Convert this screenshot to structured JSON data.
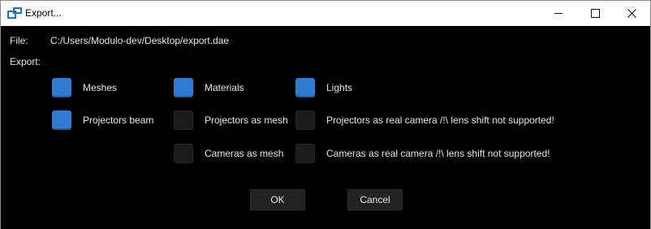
{
  "window": {
    "title": "Export...",
    "icons": {
      "app": "app-logo-icon",
      "minimize": "minimize-icon",
      "maximize": "maximize-icon",
      "close": "close-icon"
    }
  },
  "file": {
    "label": "File:",
    "path": "C:/Users/Modulo-dev/Desktop/export.dae"
  },
  "export": {
    "label": "Export:",
    "options": [
      {
        "label": "Meshes",
        "checked": true
      },
      {
        "label": "Materials",
        "checked": true
      },
      {
        "label": "Lights",
        "checked": true
      },
      {
        "label": "Projectors beam",
        "checked": true
      },
      {
        "label": "Projectors as mesh",
        "checked": false
      },
      {
        "label": "Projectors as real camera /!\\ lens shift not supported!",
        "checked": false
      },
      {
        "label": "Cameras as mesh",
        "checked": false
      },
      {
        "label": "Cameras as real camera /!\\ lens shift not supported!",
        "checked": false
      }
    ]
  },
  "buttons": {
    "ok": "OK",
    "cancel": "Cancel"
  },
  "colors": {
    "checked": "#2f7ad2",
    "unchecked": "#1c1c1c",
    "background": "#000000",
    "accent_icon": "#1f6fd1"
  }
}
